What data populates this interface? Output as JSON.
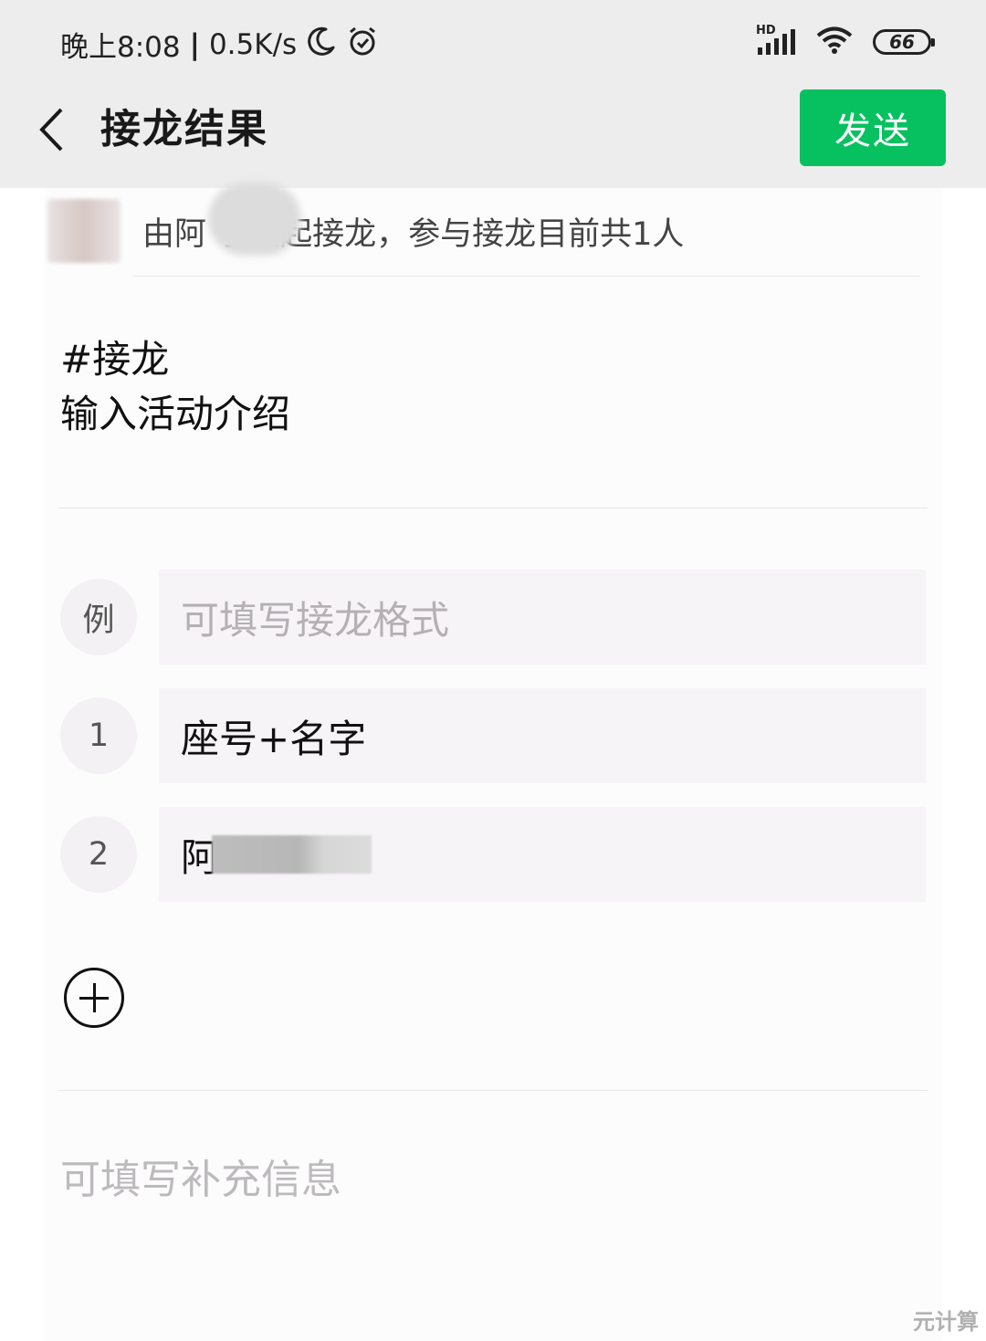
{
  "status_bar": {
    "time": "晚上8:08",
    "separator": "|",
    "net_speed": "0.5K/s",
    "signal_label": "HD",
    "battery": "66",
    "icons": [
      "moon-icon",
      "alarm-icon",
      "signal-icon",
      "wifi-icon",
      "battery-icon"
    ]
  },
  "nav": {
    "back_icon": "chevron-left-icon",
    "title": "接龙结果",
    "send_label": "发送",
    "accent_color": "#07c160"
  },
  "initiator": {
    "text": "由阿     宁发起接龙，参与接龙目前共1人"
  },
  "topic": {
    "tag": "#接龙",
    "intro": "输入活动介绍"
  },
  "rows": [
    {
      "badge": "例",
      "text": "可填写接龙格式",
      "is_placeholder": true
    },
    {
      "badge": "1",
      "text": "座号+名字",
      "is_placeholder": false
    },
    {
      "badge": "2",
      "text": "阿",
      "is_placeholder": false
    }
  ],
  "add_button": {
    "icon": "plus-circle-icon"
  },
  "extra_info": {
    "placeholder": "可填写补充信息"
  },
  "watermark": "元计算"
}
